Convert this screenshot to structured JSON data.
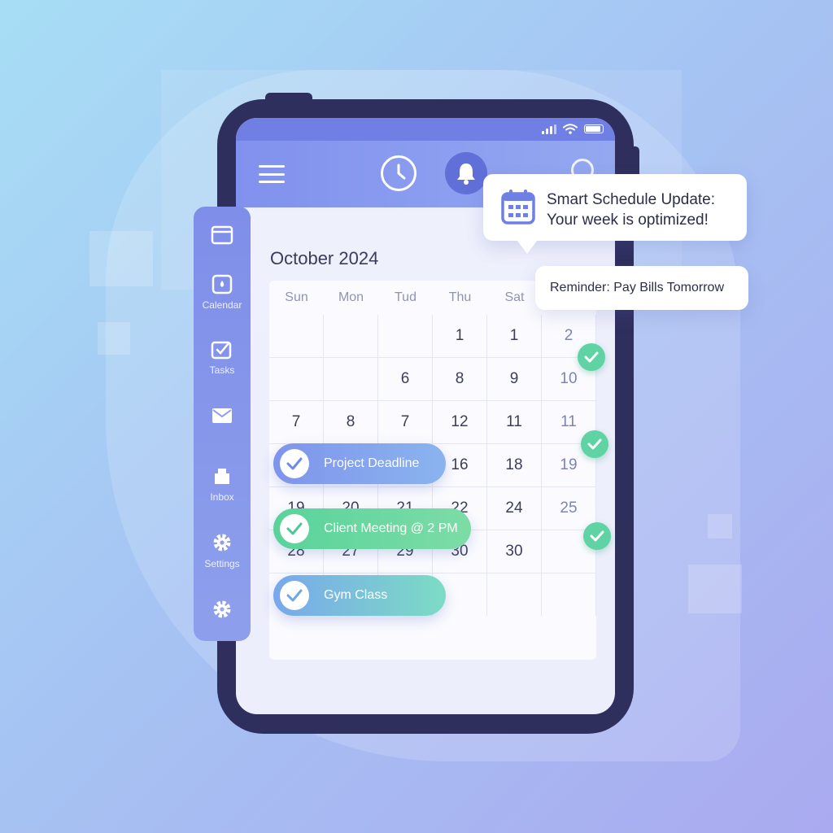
{
  "calendar": {
    "month_title": "October 2024",
    "weekdays": [
      "Sun",
      "Mon",
      "Tud",
      "Thu",
      "Sat"
    ],
    "rows": [
      [
        "",
        "",
        "",
        "1",
        "1",
        "2"
      ],
      [
        "",
        "",
        "6",
        "8",
        "9",
        "10"
      ],
      [
        "7",
        "8",
        "7",
        "12",
        "11",
        "11"
      ],
      [
        "",
        "",
        "",
        "16",
        "18",
        "19"
      ],
      [
        "19",
        "20",
        "21",
        "22",
        "24",
        "25"
      ],
      [
        "28",
        "27",
        "29",
        "30",
        "30",
        ""
      ]
    ]
  },
  "sidebar": {
    "items": [
      {
        "icon": "browser-icon",
        "label": ""
      },
      {
        "icon": "calendar-icon",
        "label": "Calendar"
      },
      {
        "icon": "tasks-icon",
        "label": "Tasks"
      },
      {
        "icon": "mail-icon",
        "label": ""
      },
      {
        "icon": "inbox-icon",
        "label": "Inbox"
      },
      {
        "icon": "gear-icon",
        "label": "Settings"
      },
      {
        "icon": "gear-icon",
        "label": ""
      }
    ]
  },
  "events": [
    {
      "label": "Project Deadline",
      "color_start": "#7f94ec",
      "color_end": "#8ab4ee"
    },
    {
      "label": "Client Meeting @ 2 PM",
      "color_start": "#59d39b",
      "color_end": "#7ddca6"
    },
    {
      "label": "Gym Class",
      "color_start": "#78a8ec",
      "color_end": "#7cdcc4"
    }
  ],
  "notification": {
    "line1": "Smart Schedule Update:",
    "line2": "Your week is optimized!"
  },
  "reminder": {
    "text": "Reminder: Pay Bills Tomorrow"
  },
  "colors": {
    "accent": "#6f7fe3",
    "check_green": "#5fd3a4",
    "device_frame": "#2f2f5e"
  }
}
